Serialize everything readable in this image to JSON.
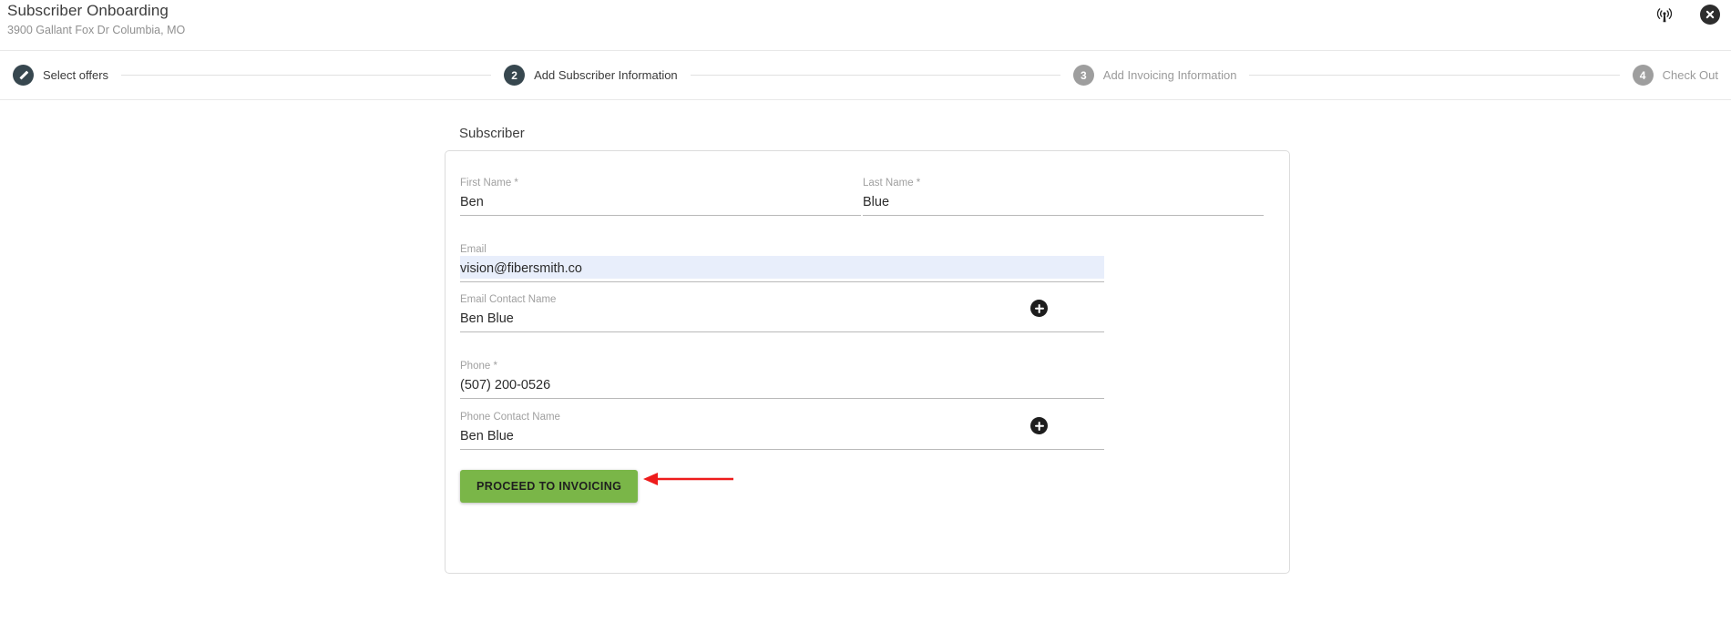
{
  "header": {
    "title": "Subscriber Onboarding",
    "subtitle": "3900 Gallant Fox Dr Columbia, MO",
    "signal_icon": "antenna-signal-icon",
    "close_icon": "close-icon"
  },
  "stepper": {
    "steps": [
      {
        "number": "1",
        "glyph": "pencil",
        "label": "Select offers",
        "state": "done"
      },
      {
        "number": "2",
        "glyph": "2",
        "label": "Add Subscriber Information",
        "state": "active"
      },
      {
        "number": "3",
        "glyph": "3",
        "label": "Add Invoicing Information",
        "state": "todo"
      },
      {
        "number": "4",
        "glyph": "4",
        "label": "Check Out",
        "state": "todo"
      }
    ]
  },
  "main": {
    "section_title": "Subscriber",
    "fields": {
      "first_name": {
        "label": "First Name *",
        "value": "Ben"
      },
      "last_name": {
        "label": "Last Name *",
        "value": "Blue"
      },
      "email": {
        "label": "Email",
        "value": "vision@fibersmith.co"
      },
      "email_contact_name": {
        "label": "Email Contact Name",
        "value": "Ben Blue"
      },
      "phone": {
        "label": "Phone *",
        "value": "(507) 200-0526"
      },
      "phone_contact_name": {
        "label": "Phone Contact Name",
        "value": "Ben Blue"
      }
    },
    "add_email_contact_icon": "plus-icon",
    "add_phone_contact_icon": "plus-icon",
    "proceed_button": "PROCEED TO INVOICING"
  },
  "colors": {
    "accent_green": "#7ab648",
    "step_active": "#37474f",
    "step_inactive": "#9e9e9e",
    "autofill_highlight": "#e8eefb",
    "annotation_red": "#ee1c1c"
  }
}
